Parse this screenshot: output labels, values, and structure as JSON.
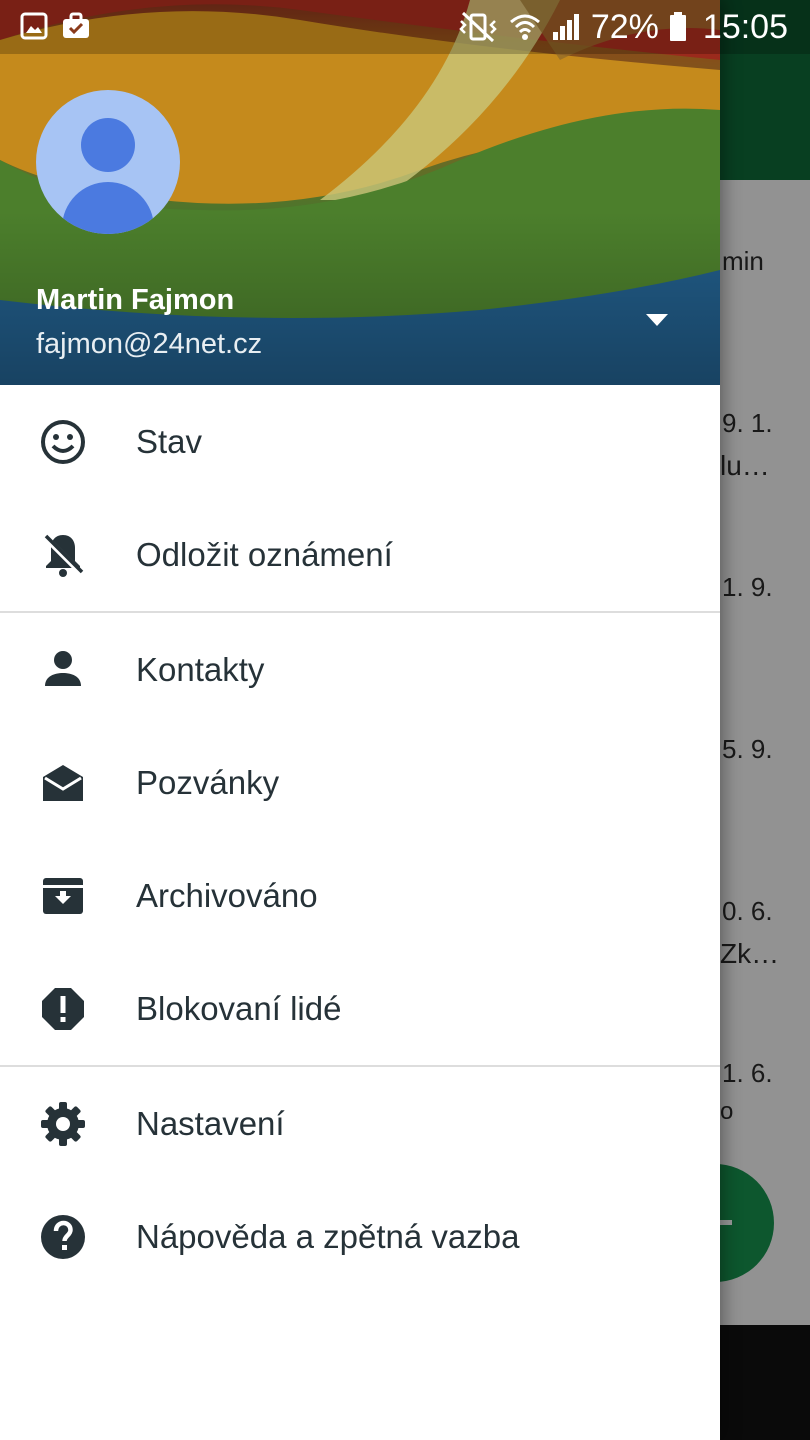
{
  "status_bar": {
    "battery": "72%",
    "time": "15:05"
  },
  "background_list": {
    "items": [
      {
        "date": "min"
      },
      {
        "date": "9. 1.",
        "snippet": "lu…"
      },
      {
        "date": "1. 9."
      },
      {
        "date": "5. 9."
      },
      {
        "date": "0. 6.",
        "snippet": "Zk…"
      },
      {
        "date": "1. 6.",
        "snippet": "o"
      }
    ]
  },
  "drawer": {
    "account": {
      "name": "Martin Fajmon",
      "email": "fajmon@24net.cz"
    },
    "groups": [
      [
        {
          "label": "Stav",
          "icon": "smiley-icon"
        },
        {
          "label": "Odložit oznámení",
          "icon": "bell-off-icon"
        }
      ],
      [
        {
          "label": "Kontakty",
          "icon": "person-icon"
        },
        {
          "label": "Pozvánky",
          "icon": "drafts-envelope-icon"
        },
        {
          "label": "Archivováno",
          "icon": "archive-icon"
        },
        {
          "label": "Blokovaní lidé",
          "icon": "blocked-alert-icon"
        }
      ],
      [
        {
          "label": "Nastavení",
          "icon": "gear-icon"
        },
        {
          "label": "Nápověda a zpětná vazba",
          "icon": "help-icon"
        }
      ]
    ]
  },
  "colors": {
    "app_bar": "#0e6a37",
    "fab": "#17914d",
    "menu_text": "#263238",
    "icon": "#263238"
  }
}
